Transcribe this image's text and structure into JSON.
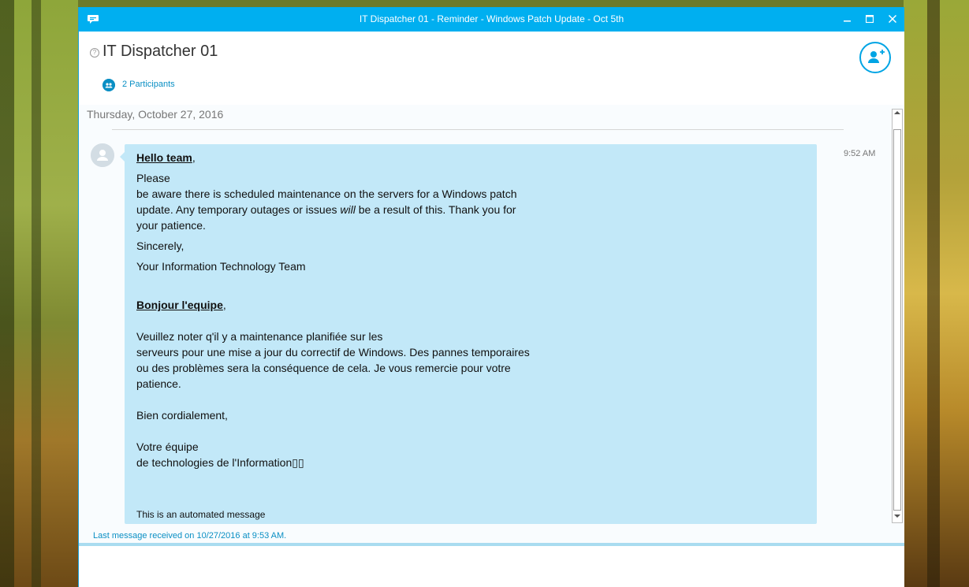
{
  "window": {
    "title": "IT Dispatcher 01 - Reminder - Windows Patch Update - Oct 5th",
    "controls": {
      "minimize": "—",
      "maximize": "☐",
      "close": "✕"
    }
  },
  "header": {
    "conversation_title": "IT Dispatcher 01",
    "help_glyph": "?",
    "participants_label": "2 Participants"
  },
  "chat": {
    "date_separator": "Thursday, October 27, 2016",
    "message": {
      "timestamp": "9:52 AM",
      "greeting_en": "Hello team",
      "greeting_en_punct": ",",
      "line_please": "Please",
      "line_en_1": "be aware there is scheduled maintenance on the servers for a Windows patch",
      "line_en_2a": "update. Any temporary outages or issues ",
      "line_en_2_italic": "will",
      "line_en_2b": " be a result of this. Thank you for",
      "line_en_3": "your patience.",
      "sincerely": "Sincerely,",
      "signature_en": "Your Information Technology Team",
      "greeting_fr": "Bonjour l'equipe",
      "greeting_fr_punct": ",",
      "line_fr_1": "Veuillez noter q'il y a maintenance planifiée sur les",
      "line_fr_2": "serveurs pour une mise a jour du correctif de Windows. Des pannes temporaires",
      "line_fr_3": "ou des problèmes sera la conséquence de cela. Je vous remercie pour votre",
      "line_fr_4": "patience.",
      "closing_fr": "Bien cordialement,",
      "signature_fr_1": "Votre équipe",
      "signature_fr_2": "de technologies de l'Information",
      "signature_fr_glyphs": "▯▯",
      "automated": "This is an automated message"
    }
  },
  "status": {
    "last_received": "Last message received on 10/27/2016 at 9:53 AM."
  },
  "colors": {
    "title_bar": "#00aff0",
    "bubble": "#c2e8f8",
    "accent": "#0a8fc4"
  }
}
